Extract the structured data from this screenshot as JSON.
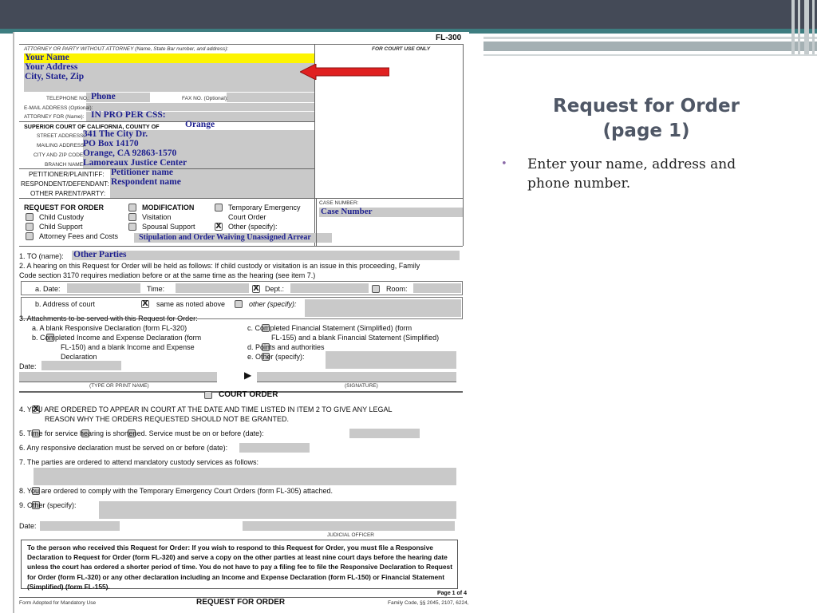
{
  "slide": {
    "title_line1": "Request for Order",
    "title_line2": "(page 1)",
    "bullets": [
      "Enter your name, address and phone number."
    ]
  },
  "colors": {
    "top_band": "#444a57",
    "teal": "#3d7d80",
    "arrow": "#e02020",
    "fill_text": "#1d1f8f",
    "highlight": "#fdf400",
    "title": "#4f5766"
  },
  "form": {
    "form_number": "FL-300",
    "header": {
      "attorney_label": "ATTORNEY OR PARTY WITHOUT ATTORNEY (Name, State Bar number, and address):",
      "court_use_label": "FOR COURT USE ONLY",
      "your_name": "Your Name",
      "your_address": "Your Address",
      "city_state_zip": "City, State, Zip",
      "telephone_label": "TELEPHONE NO.:",
      "phone": "Phone",
      "fax_label": "FAX NO. (Optional):",
      "email_label": "E-MAIL ADDRESS (Optional):",
      "attorney_for_label": "ATTORNEY FOR (Name):",
      "attorney_for_value": "IN PRO PER    CSS:",
      "court_county_label": "SUPERIOR COURT OF CALIFORNIA, COUNTY OF",
      "county": "Orange",
      "street_label": "STREET ADDRESS:",
      "street": "341 The City Dr.",
      "mailing_label": "MAILING ADDRESS:",
      "mailing": "PO Box 14170",
      "city_zip_label": "CITY AND ZIP CODE:",
      "city_zip": "Orange, CA  92863-1570",
      "branch_label": "BRANCH NAME:",
      "branch": "Lamoreaux Justice Center",
      "petitioner_label": "PETITIONER/PLAINTIFF:",
      "petitioner": "Petitioner name",
      "respondent_label": "RESPONDENT/DEFENDANT:",
      "respondent": "Respondent name",
      "other_parent_label": "OTHER PARENT/PARTY:"
    },
    "request": {
      "title": "REQUEST FOR ORDER",
      "child_custody": "Child Custody",
      "child_support": "Child Support",
      "attorney_fees": "Attorney Fees and Costs",
      "modification": "MODIFICATION",
      "visitation": "Visitation",
      "spousal_support": "Spousal Support",
      "temp_emergency_1": "Temporary Emergency",
      "temp_emergency_2": "Court Order",
      "other_specify": "Other (specify):",
      "other_value": "Stipulation and Order Waiving Unassigned Arrear",
      "case_number_label": "CASE NUMBER:",
      "case_number": "Case Number",
      "check_mark": "X"
    },
    "items": {
      "item1_label": "1.   TO (name):",
      "item1_value": "Other Parties",
      "item2_line1": "2.   A hearing on this Request for Order will be held as follows: If child custody or visitation is an issue in this proceeding, Family",
      "item2_line2": "Code section 3170 requires mediation before or at the same time as the hearing (see item 7.)",
      "date_label": "a.  Date:",
      "time_label": "Time:",
      "dept_label": "Dept.:",
      "room_label": "Room:",
      "address_label": "b.  Address of court",
      "same_as_label": "same as noted above",
      "other_label": "other (specify):",
      "item3": "3.   Attachments to be served with this Request for Order:",
      "item3a": "a.   A blank Responsive Declaration (form FL-320)",
      "item3b_1": "b.         Completed Income and Expense Declaration (form",
      "item3b_2": "FL-150) and a blank Income and Expense",
      "item3b_3": "Declaration",
      "item3c_1": "c.         Completed Financial Statement (Simplified) (form",
      "item3c_2": "FL-155) and a blank Financial Statement (Simplified)",
      "item3d": "d.         Points and authorities",
      "item3e": "e.         Other (specify):",
      "date_sig_label": "Date:",
      "type_print_label": "(TYPE OR PRINT NAME)",
      "signature_label": "(SIGNATURE)",
      "court_order_title": "COURT ORDER",
      "item4_1": "4.         YOU ARE ORDERED TO APPEAR IN COURT AT THE DATE AND TIME LISTED IN ITEM 2 TO GIVE ANY LEGAL",
      "item4_2": "REASON WHY THE ORDERS REQUESTED SHOULD NOT BE GRANTED.",
      "item5": "5.         Time for           service           hearing          is shortened. Service must be on or before (date):",
      "item6": "6.   Any responsive declaration must be served on or before (date):",
      "item7": "7.   The parties are ordered to attend mandatory custody services as follows:",
      "item8": "8.         You are ordered to comply with the Temporary Emergency Court Orders (form FL-305) attached.",
      "item9": "9.         Other (specify):",
      "date_judge_label": "Date:",
      "judicial_officer_label": "JUDICIAL OFFICER"
    },
    "notice": "To the person who received this Request for Order: If you wish to respond to this Request for Order, you must file a Responsive Declaration to Request for Order (form FL-320) and serve a copy on the other parties at least nine court days before the hearing date unless the court has ordered a shorter period of time. You do not have to pay a filing fee to file the Responsive Declaration to Request for Order (form FL-320) or any other declaration including an Income and Expense Declaration (form FL-150) or Financial Statement (Simplified) (form FL-155).",
    "footer": {
      "page_label": "Page 1 of 4",
      "adopted_label": "Form Adopted for Mandatory Use",
      "title": "REQUEST FOR ORDER",
      "code_ref": "Family Code, §§ 2045, 2107, 6224,"
    }
  }
}
